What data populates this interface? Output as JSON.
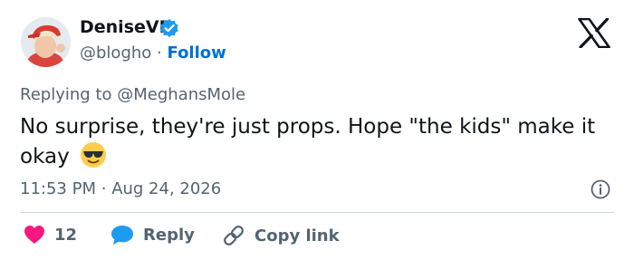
{
  "author": {
    "display_name": "DeniseVB",
    "handle": "@blogho",
    "separator": "·",
    "follow_label": "Follow"
  },
  "reply_context": {
    "prefix": "Replying to",
    "target": "@MeghansMole"
  },
  "tweet": {
    "text": "No surprise, they're just props.  Hope \"the kids\" make it okay"
  },
  "meta": {
    "time": "11:53 PM",
    "separator": "·",
    "date": "Aug 24, 2026"
  },
  "actions": {
    "like_count": "12",
    "reply_label": "Reply",
    "copy_label": "Copy link"
  },
  "colors": {
    "accent": "#1d9bf0",
    "follow": "#006fd6",
    "like": "#f91880",
    "text": "#0f1419",
    "muted": "#536471"
  },
  "icons": [
    "verified-badge-icon",
    "x-logo-icon",
    "sunglasses-emoji-icon",
    "info-icon",
    "heart-icon",
    "reply-bubble-icon",
    "link-icon"
  ]
}
